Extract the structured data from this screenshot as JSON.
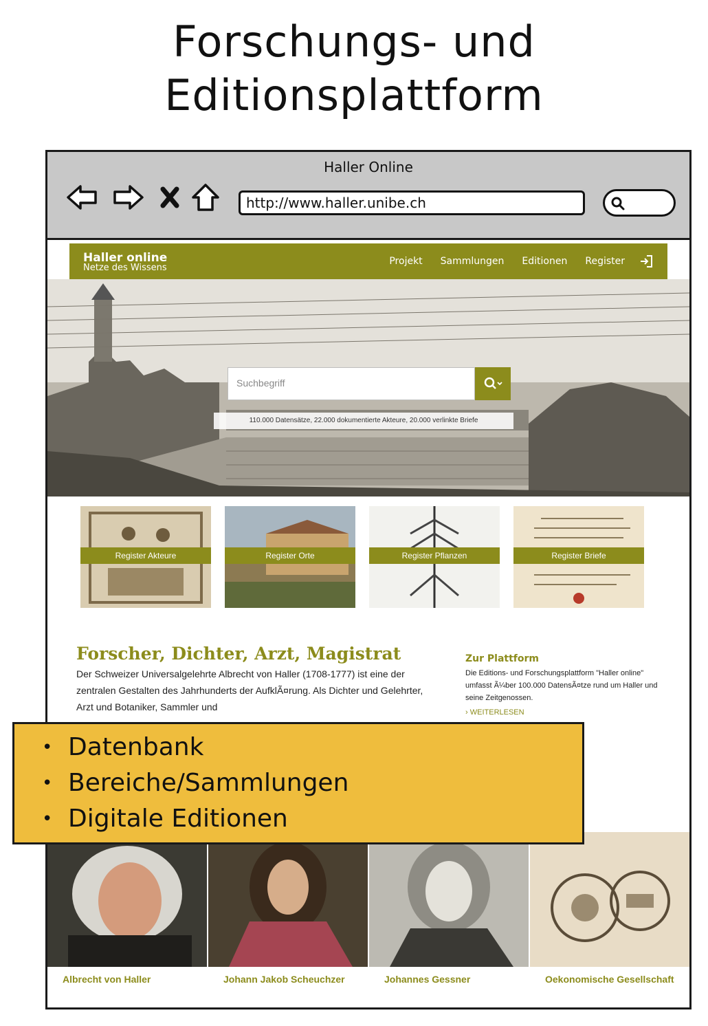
{
  "slide": {
    "title_line1": "Forschungs- und",
    "title_line2": "Editionsplattform"
  },
  "browser": {
    "window_title": "Haller Online",
    "url": "http://www.haller.unibe.ch"
  },
  "site": {
    "brand_name": "Haller online",
    "brand_tagline": "Netze des Wissens",
    "menu": [
      "Projekt",
      "Sammlungen",
      "Editionen",
      "Register"
    ],
    "search_placeholder": "Suchbegriff",
    "stats": "110.000 Datensätze, 22.000 dokumentierte Akteure, 20.000 verlinkte Briefe",
    "registers": [
      "Register Akteure",
      "Register Orte",
      "Register Pflanzen",
      "Register Briefe"
    ],
    "intro": {
      "heading": "Forscher, Dichter, Arzt, Magistrat",
      "text": "Der Schweizer Universalgelehrte Albrecht von Haller (1708-1777) ist eine der zentralen Gestalten des Jahrhunderts der AufklÃ¤rung. Als Dichter und Gelehrter, Arzt und Botaniker, Sammler und"
    },
    "platform": {
      "heading": "Zur Plattform",
      "text": "Die Editions- und Forschungsplattform \"Haller online\" umfasst Ã¼ber 100.000 DatensÃ¤tze rund um Haller und seine Zeitgenossen.",
      "more": "WEITERLESEN"
    },
    "people": [
      "Albrecht von Haller",
      "Johann Jakob Scheuchzer",
      "Johannes Gessner",
      "Oekonomische Gesellschaft"
    ]
  },
  "callout": {
    "items": [
      "Datenbank",
      "Bereiche/Sammlungen",
      "Digitale Editionen"
    ]
  },
  "colors": {
    "accent": "#8c8c1c",
    "callout": "#efbd3d",
    "chrome": "#c8c8c8"
  }
}
